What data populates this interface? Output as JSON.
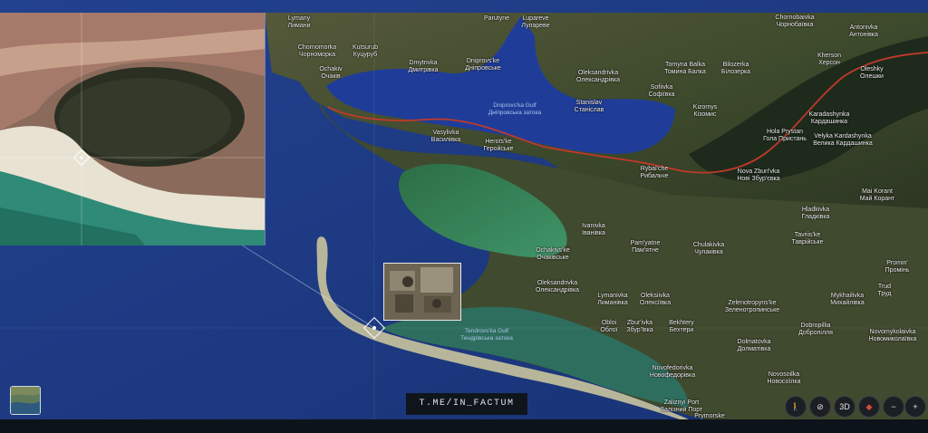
{
  "watermark": "T.ME/IN_FACTUM",
  "places": [
    {
      "key": "lymany",
      "en": "Lymany",
      "uk": "Лимани"
    },
    {
      "key": "chornomorka",
      "en": "Chornomorka",
      "uk": "Чорноморка"
    },
    {
      "key": "kutsurub",
      "en": "Kutsurub",
      "uk": "Куцуруб"
    },
    {
      "key": "ochakiv",
      "en": "Ochakiv",
      "uk": "Очаків"
    },
    {
      "key": "dmytrivka",
      "en": "Dmytrivka",
      "uk": "Дмитрівка"
    },
    {
      "key": "dniprovske",
      "en": "Dniprovs'ke",
      "uk": "Дніпровське"
    },
    {
      "key": "parutyne",
      "en": "Parutyne",
      "uk": ""
    },
    {
      "key": "lupareve",
      "en": "Lupareve",
      "uk": "Лупареве"
    },
    {
      "key": "oleksandrivka1",
      "en": "Oleksandrivka",
      "uk": "Олександрівка"
    },
    {
      "key": "tomyna_balka",
      "en": "Tomyna Balka",
      "uk": "Томина Балка"
    },
    {
      "key": "bilozerka",
      "en": "Bilozerka",
      "uk": "Білозерка"
    },
    {
      "key": "chornobaivka",
      "en": "Chornobaivka",
      "uk": "Чорнобаївка"
    },
    {
      "key": "antonivka",
      "en": "Antonivka",
      "uk": "Антонівка"
    },
    {
      "key": "kherson",
      "en": "Kherson",
      "uk": "Херсон"
    },
    {
      "key": "oleshky",
      "en": "Oleshky",
      "uk": "Олешки"
    },
    {
      "key": "sofiivka",
      "en": "Sofiivka",
      "uk": "Софіївка"
    },
    {
      "key": "stanislav",
      "en": "Stanislav",
      "uk": "Станіслав"
    },
    {
      "key": "kizomys",
      "en": "Kizomys",
      "uk": "Кізомис"
    },
    {
      "key": "karadashynka",
      "en": "Karadashynka",
      "uk": "Кардашинка"
    },
    {
      "key": "vasylivka",
      "en": "Vasylivka",
      "uk": "Василівка"
    },
    {
      "key": "heroiske",
      "en": "Heroïs'ke",
      "uk": "Геройське"
    },
    {
      "key": "hola_prystan",
      "en": "Hola Prystan",
      "uk": "Гола Пристань"
    },
    {
      "key": "velyka_kardashynka",
      "en": "Velyka Kardashynka",
      "uk": "Велика Кардашинка"
    },
    {
      "key": "rybalche",
      "en": "Rybal'che",
      "uk": "Рибальче"
    },
    {
      "key": "nova_zburivka",
      "en": "Nova Zburi'vka",
      "uk": "Нові Збур'євка"
    },
    {
      "key": "mai_korant",
      "en": "Mai Korant",
      "uk": "Май Корант"
    },
    {
      "key": "hladkivka",
      "en": "Hladkivka",
      "uk": "Гладківка"
    },
    {
      "key": "ivanivka",
      "en": "Ivanivka",
      "uk": "Іванівка"
    },
    {
      "key": "pamiatne",
      "en": "Pam'yatne",
      "uk": "Пам'ятне"
    },
    {
      "key": "chulakivka",
      "en": "Chulakivka",
      "uk": "Чулаківка"
    },
    {
      "key": "tavriiske",
      "en": "Tavriis'ke",
      "uk": "Таврійське"
    },
    {
      "key": "ochakivske",
      "en": "Ochakivs'ke",
      "uk": "Очаківське"
    },
    {
      "key": "oleksandrivka2",
      "en": "Oleksandrivka",
      "uk": "Олександрівка"
    },
    {
      "key": "lymanivka",
      "en": "Lymanivka",
      "uk": "Лиманівка"
    },
    {
      "key": "oleksiivka",
      "en": "Oleksiivka",
      "uk": "Олексіївка"
    },
    {
      "key": "zelenotropynske",
      "en": "Zelenotropyns'ke",
      "uk": "Зеленотропинське"
    },
    {
      "key": "mykhailivka",
      "en": "Mykhailivka",
      "uk": "Михайлівка"
    },
    {
      "key": "trud",
      "en": "Trud",
      "uk": "Труд"
    },
    {
      "key": "promin",
      "en": "Promin'",
      "uk": "Промінь"
    },
    {
      "key": "obloi",
      "en": "Obloi",
      "uk": "Облої"
    },
    {
      "key": "zburivka",
      "en": "Zbur'ivka",
      "uk": "Збур'ївка"
    },
    {
      "key": "bekhtery",
      "en": "Bekhtery",
      "uk": "Бехтери"
    },
    {
      "key": "dobropillia",
      "en": "Dobropillia",
      "uk": "Добропілля"
    },
    {
      "key": "novomykolaivka",
      "en": "Novomykolaivka",
      "uk": "Новомиколаївка"
    },
    {
      "key": "dolmatovka",
      "en": "Dolmatovka",
      "uk": "Долматівка"
    },
    {
      "key": "novofedorivka",
      "en": "Novofedorivka",
      "uk": "Новофедорівка"
    },
    {
      "key": "novosoilka",
      "en": "Novosoilka",
      "uk": "Новосоїлка"
    },
    {
      "key": "zaliznyi_port",
      "en": "Zaliznyi Port",
      "uk": "Залізний Порт"
    },
    {
      "key": "prymorske",
      "en": "Prymorske",
      "uk": ""
    }
  ],
  "water": [
    {
      "key": "dnieper_gulf",
      "en": "Dniprovs'ka Gulf",
      "uk": "Дніпровська затока"
    },
    {
      "key": "tendra_gulf",
      "en": "Tendrovs'ka Gulf",
      "uk": "Тендрівська затока"
    }
  ],
  "controls": {
    "person": "🚶",
    "rotate": "⊘",
    "three_d": "3D",
    "compass": "◆",
    "zoom_out": "−",
    "zoom_in": "+"
  },
  "colors": {
    "frontline": "#c0392b",
    "sea": "#1c3a8c",
    "land": "#37402a",
    "gulf": "#1f3f96",
    "lagoon": "#2f7a50"
  }
}
